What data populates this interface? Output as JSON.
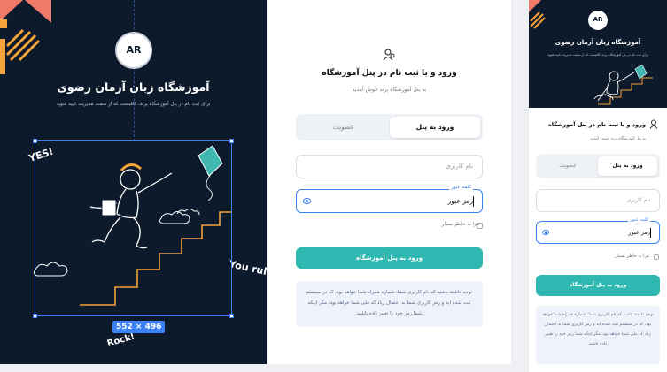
{
  "hero": {
    "title": "آموزشگاه زبان آرمان رضوی",
    "subtitle": "برای ثبت نام در پنل آموزشگاه پرند، کافیست که از سمت مدیریت تایید شوید",
    "logo_text": "AR",
    "doodle_yes": "YES!",
    "doodle_rule": "You rule!",
    "doodle_rock": "Rock!",
    "selection_size": "552 × 496"
  },
  "form": {
    "icon": "user-icon",
    "title": "ورود و یا ثبت نام در پنل آموزشگاه",
    "subtitle": "به پنل آموزشگاه پرند خوش آمدید",
    "tab_login": "ورود به پنل",
    "tab_register": "عضویت",
    "username_placeholder": "نام کاربری",
    "password_label": "کلمه عبور",
    "password_value": "رمز عبور",
    "remember_label": "مرا به خاطر بسپار",
    "submit_label": "ورود به پنل آموزشگاه",
    "note": "توجه داشته باشید که نام کاربری شما، شماره همراه شما خواهد بود، که در سیستم ثبت شده اید و رمز کاربری شما به احتمال زیاد کد ملی شما خواهد بود، مگر اینکه شما رمز خود را تغییر داده باشید"
  },
  "colors": {
    "hero_bg": "#0d1a2b",
    "accent": "#2fb8b1",
    "focus": "#3b82f6",
    "shape_orange": "#f3a33a",
    "shape_salmon": "#f07a6a",
    "kite": "#3fb6b0"
  }
}
